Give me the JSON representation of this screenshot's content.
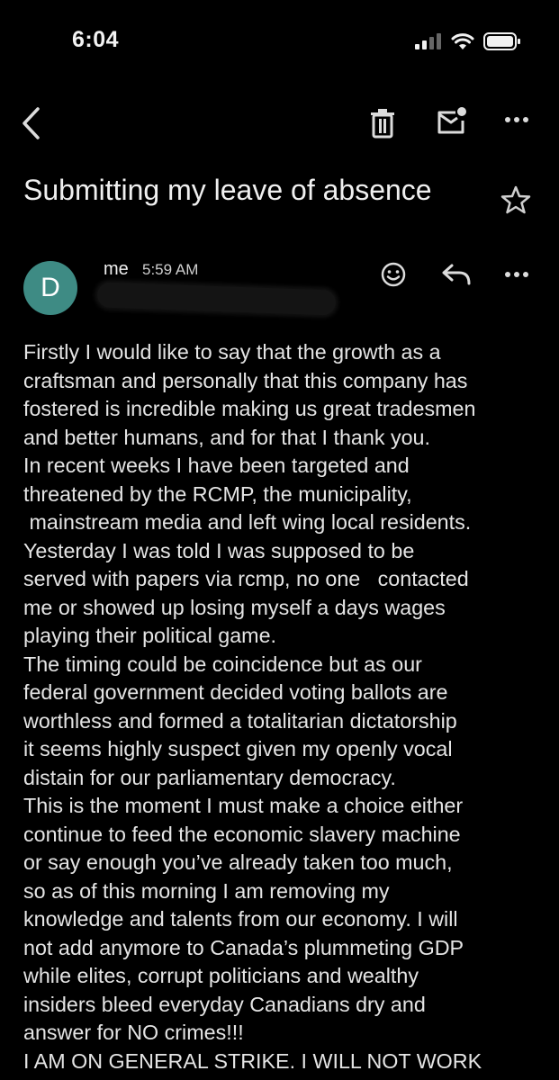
{
  "status_bar": {
    "time": "6:04",
    "icons": [
      "cellular-signal-icon",
      "wifi-icon",
      "battery-icon"
    ]
  },
  "toolbar": {
    "back_icon": "chevron-left-icon",
    "delete_icon": "trash-icon",
    "mark_unread_icon": "mail-unread-icon",
    "more_icon": "more-horizontal-icon"
  },
  "email": {
    "subject": "Submitting my leave of absence",
    "star_icon": "star-outline-icon",
    "sender_initial": "D",
    "sender_name": "me",
    "time": "5:59 AM",
    "avatar_color": "#3e8b84",
    "actions": [
      "emoji-reaction-icon",
      "reply-icon",
      "more-horizontal-icon"
    ],
    "body_lines": [
      "Firstly I would like to say that the growth as a",
      "craftsman and personally that this company has",
      "fostered is incredible making us great tradesmen",
      "and better humans, and for that I thank you.",
      "In recent weeks I have been targeted and",
      "threatened by the RCMP, the municipality,",
      " mainstream media and left wing local residents.",
      "Yesterday I was told I was supposed to be",
      "served with papers via rcmp, no one   contacted",
      "me or showed up losing myself a days wages",
      "playing their political game.",
      "The timing could be coincidence but as our",
      "federal government decided voting ballots are",
      "worthless and formed a totalitarian dictatorship",
      "it seems highly suspect given my openly vocal",
      "distain for our parliamentary democracy.",
      "This is the moment I must make a choice either",
      "continue to feed the economic slavery machine",
      "or say enough you’ve already taken too much,",
      "so as of this morning I am removing my",
      "knowledge and talents from our economy. I will",
      "not add anymore to Canada’s plummeting GDP",
      "while elites, corrupt politicians and wealthy",
      "insiders bleed everyday Canadians dry and",
      "answer for NO crimes!!!",
      "I AM ON GENERAL STRIKE. I WILL NOT WORK"
    ]
  }
}
